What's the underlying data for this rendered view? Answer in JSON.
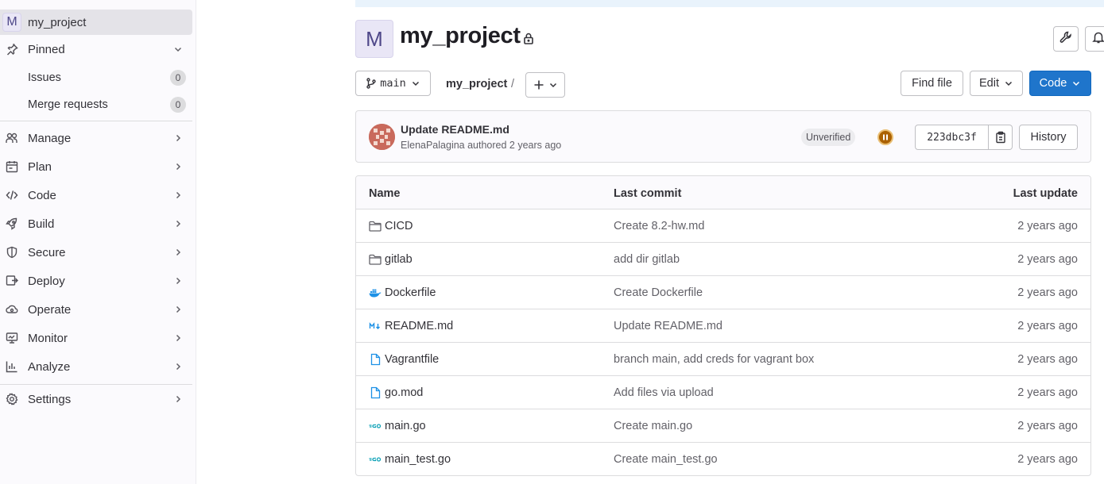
{
  "sidebar": {
    "project": {
      "avatar_letter": "M",
      "name": "my_project"
    },
    "pinned": {
      "label": "Pinned"
    },
    "pinned_items": [
      {
        "label": "Issues",
        "count": "0"
      },
      {
        "label": "Merge requests",
        "count": "0"
      }
    ],
    "menu": [
      {
        "label": "Manage",
        "icon": "users-icon"
      },
      {
        "label": "Plan",
        "icon": "planning-icon"
      },
      {
        "label": "Code",
        "icon": "code-icon"
      },
      {
        "label": "Build",
        "icon": "rocket-icon"
      },
      {
        "label": "Secure",
        "icon": "shield-icon"
      },
      {
        "label": "Deploy",
        "icon": "deployments-icon"
      },
      {
        "label": "Operate",
        "icon": "cloud-gear-icon"
      },
      {
        "label": "Monitor",
        "icon": "monitor-icon"
      },
      {
        "label": "Analyze",
        "icon": "chart-icon"
      }
    ],
    "settings": {
      "label": "Settings",
      "icon": "settings-icon"
    }
  },
  "header": {
    "avatar_letter": "M",
    "title": "my_project"
  },
  "toolbar": {
    "branch": "main",
    "breadcrumb": "my_project",
    "breadcrumb_sep": "/",
    "find_file": "Find file",
    "edit": "Edit",
    "code": "Code"
  },
  "commit": {
    "title": "Update README.md",
    "meta": "ElenaPalagina authored 2 years ago",
    "badge": "Unverified",
    "sha": "223dbc3f",
    "history": "History"
  },
  "table": {
    "headers": {
      "name": "Name",
      "last_commit": "Last commit",
      "last_update": "Last update"
    },
    "rows": [
      {
        "name": "CICD",
        "icon": "folder-icon",
        "commit": "Create 8.2-hw.md",
        "date": "2 years ago"
      },
      {
        "name": "gitlab",
        "icon": "folder-icon",
        "commit": "add dir gitlab",
        "date": "2 years ago"
      },
      {
        "name": "Dockerfile",
        "icon": "docker-icon",
        "commit": "Create Dockerfile",
        "date": "2 years ago"
      },
      {
        "name": "README.md",
        "icon": "markdown-icon",
        "commit": "Update README.md",
        "date": "2 years ago"
      },
      {
        "name": "Vagrantfile",
        "icon": "file-icon",
        "commit": "branch main, add creds for vagrant box",
        "date": "2 years ago"
      },
      {
        "name": "go.mod",
        "icon": "file-icon",
        "commit": "Add files via upload",
        "date": "2 years ago"
      },
      {
        "name": "main.go",
        "icon": "go-icon",
        "commit": "Create main.go",
        "date": "2 years ago"
      },
      {
        "name": "main_test.go",
        "icon": "go-icon",
        "commit": "Create main_test.go",
        "date": "2 years ago"
      }
    ]
  },
  "colors": {
    "primary": "#1f75cb",
    "pipeline": "#ab6100",
    "avatar_bg": "#e9e6f6"
  }
}
